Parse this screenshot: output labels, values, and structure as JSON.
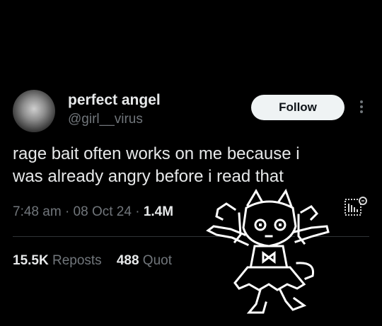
{
  "author": {
    "display_name": "perfect angel",
    "handle": "@girl__virus"
  },
  "follow_button": "Follow",
  "tweet_lines": [
    "rage bait often works on me because i",
    "was already angry before i read that"
  ],
  "meta": {
    "time": "7:48 am",
    "date": "08 Oct 24",
    "views": "1.4M",
    "separator": "·"
  },
  "stats": {
    "reposts_count": "15.5K",
    "reposts_label": "Reposts",
    "quotes_count": "488",
    "quotes_label": "Quot"
  },
  "icons": {
    "more": "more-dots-icon",
    "analytics": "analytics-icon"
  },
  "colors": {
    "background": "#000000",
    "text": "#e7e9ea",
    "secondary": "#71767b",
    "button_bg": "#eff3f4"
  }
}
